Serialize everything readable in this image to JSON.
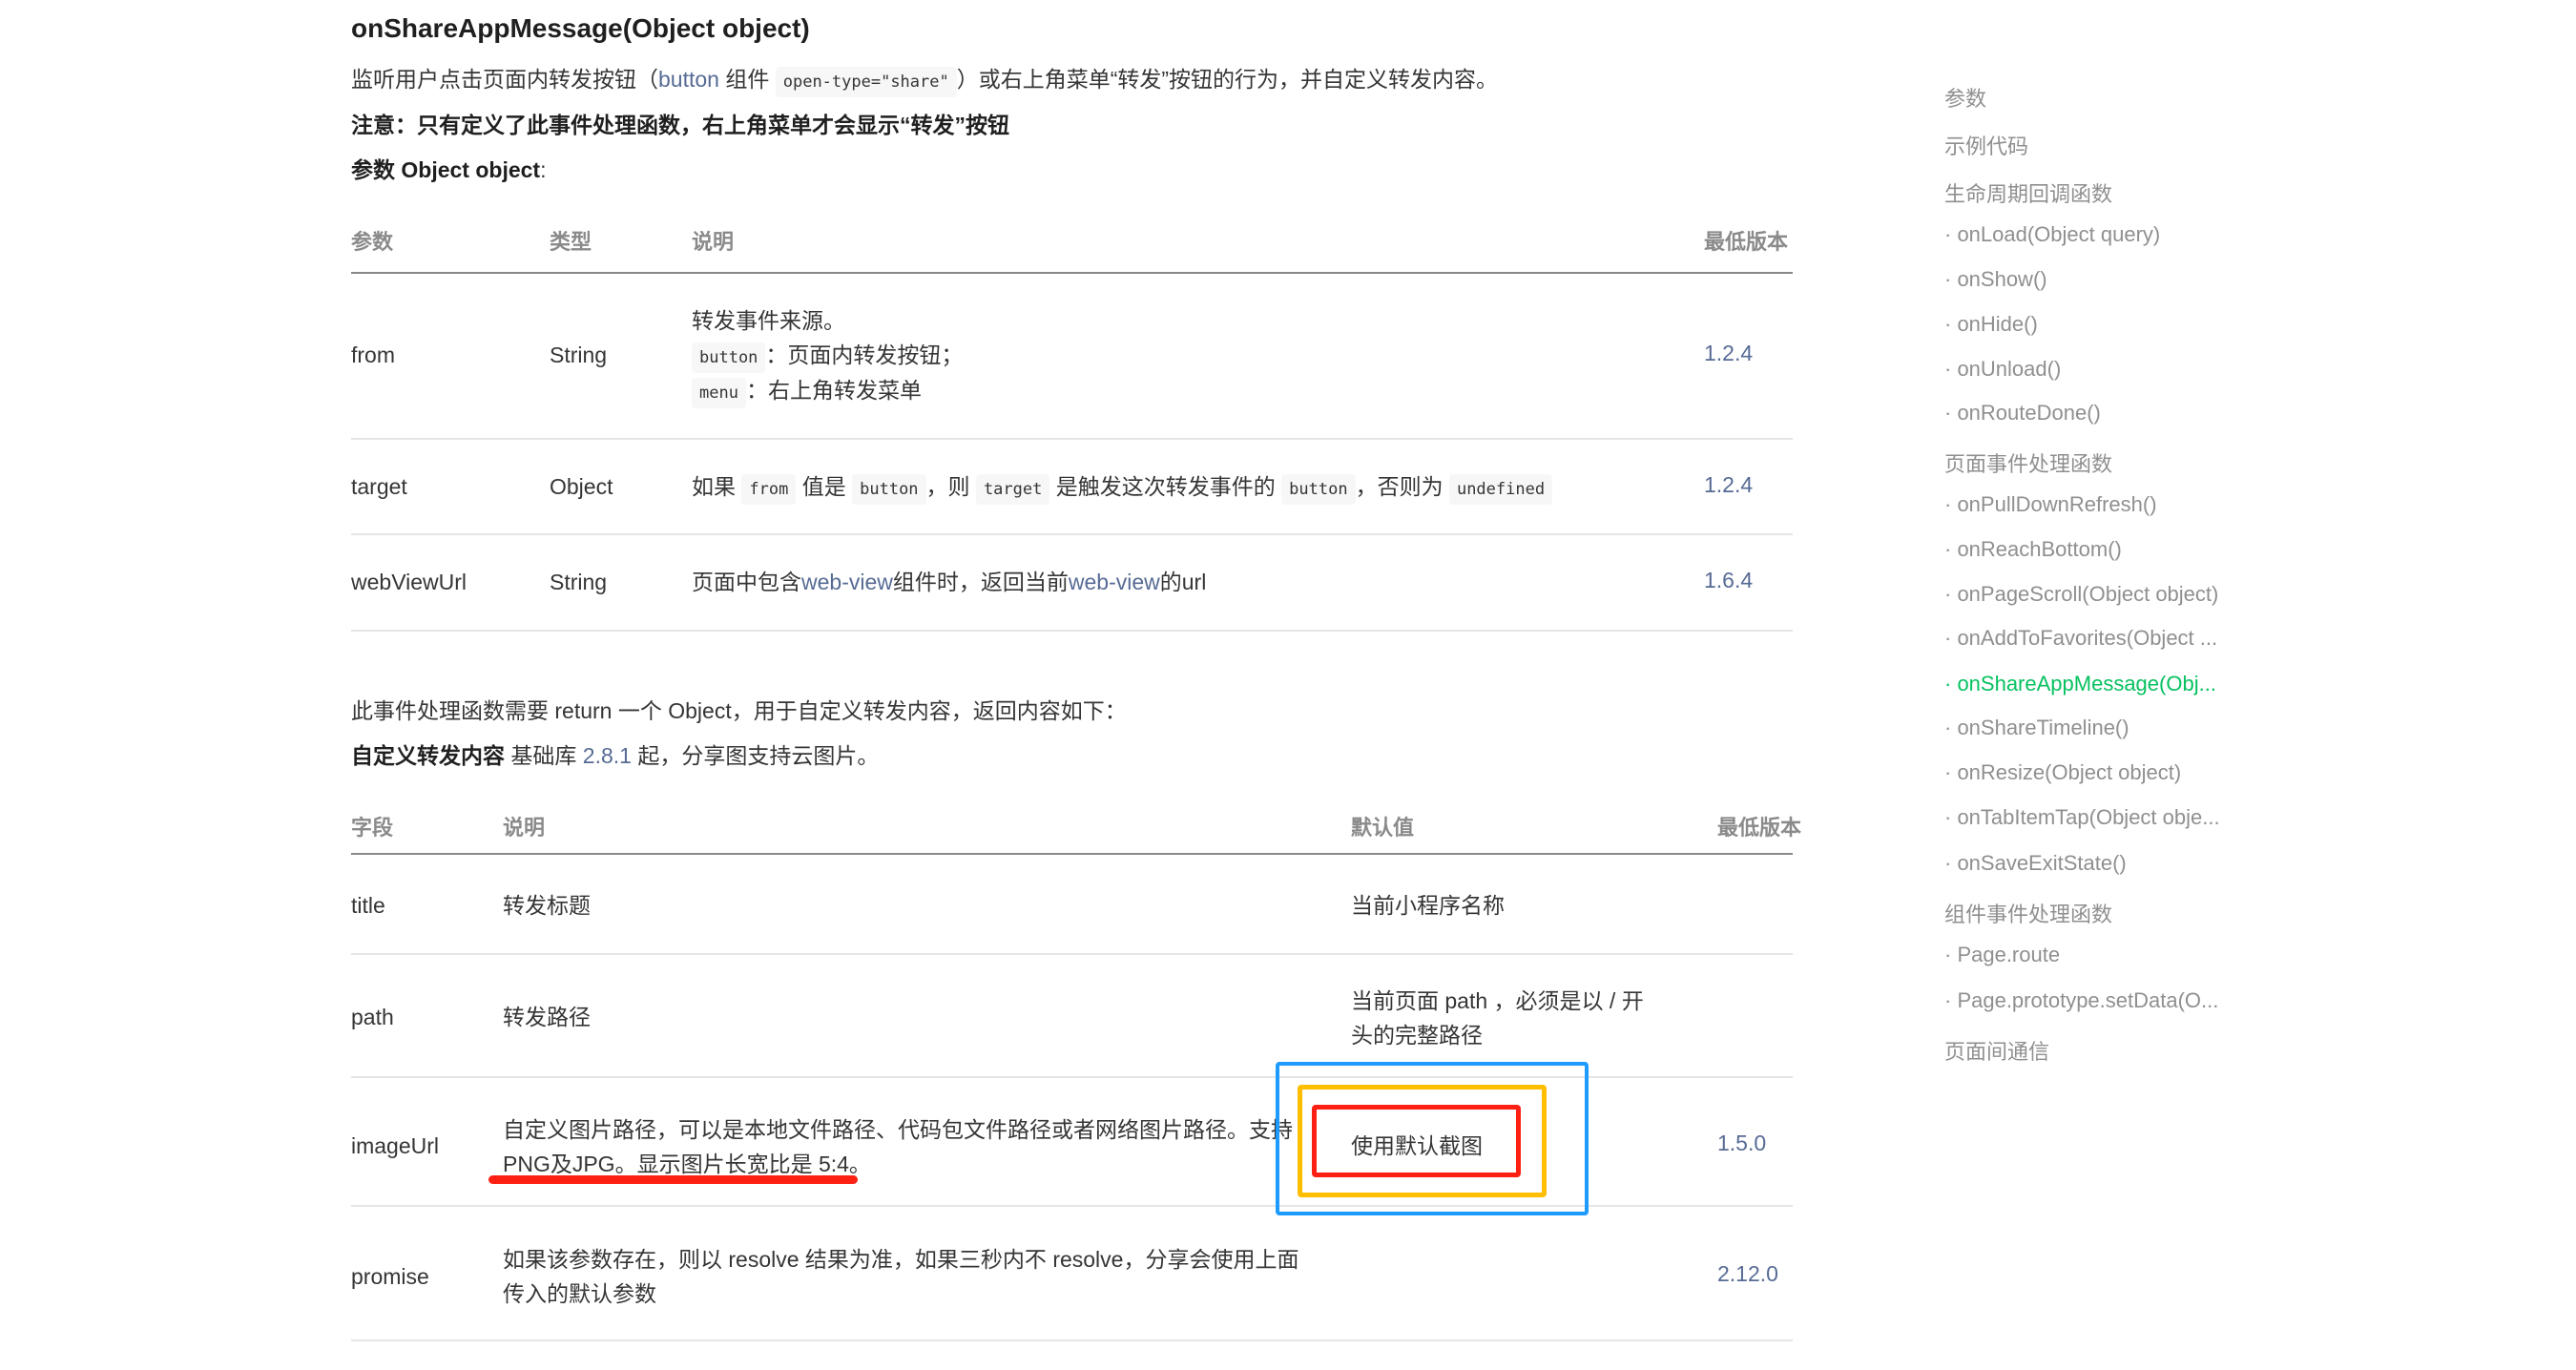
{
  "header": {
    "title": "onShareAppMessage(Object object)",
    "desc": {
      "prefix": "监听用户点击页面内转发按钮（",
      "link": "button",
      "mid": " 组件 ",
      "code": "open-type=\"share\"",
      "suffix": "）或右上角菜单“转发”按钮的行为，并自定义转发内容。"
    },
    "note": "注意：只有定义了此事件处理函数，右上角菜单才会显示“转发”按钮",
    "param_label_bold": "参数 Object object",
    "param_label_tail": ":"
  },
  "table1": {
    "headers": [
      "参数",
      "类型",
      "说明",
      "最低版本"
    ],
    "rows": [
      {
        "name": "from",
        "type": "String",
        "desc_lines": [
          {
            "text": "转发事件来源。"
          },
          {
            "code": "button",
            "text": "：页面内转发按钮；"
          },
          {
            "code": "menu",
            "text": "：右上角转发菜单"
          }
        ],
        "version": "1.2.4"
      },
      {
        "name": "target",
        "type": "Object",
        "desc_parts": [
          "如果 ",
          "from",
          " 值是 ",
          "button",
          "，则 ",
          "target",
          " 是触发这次转发事件的 ",
          "button",
          "，否则为 ",
          "undefined"
        ],
        "version": "1.2.4"
      },
      {
        "name": "webViewUrl",
        "type": "String",
        "desc_parts": [
          "页面中包含",
          "web-view",
          "组件时，返回当前",
          "web-view",
          "的url"
        ],
        "version": "1.6.4"
      }
    ]
  },
  "middle": {
    "return_text": "此事件处理函数需要 return 一个 Object，用于自定义转发内容，返回内容如下：",
    "custom_bold": "自定义转发内容",
    "custom_pre": " 基础库 ",
    "custom_link": "2.8.1",
    "custom_post": " 起，分享图支持云图片。"
  },
  "table2": {
    "headers": [
      "字段",
      "说明",
      "默认值",
      "最低版本"
    ],
    "rows": [
      {
        "field": "title",
        "desc": "转发标题",
        "default": "当前小程序名称",
        "version": ""
      },
      {
        "field": "path",
        "desc": "转发路径",
        "default_lines": [
          "当前页面 path ，必须是以 / 开",
          "头的完整路径"
        ],
        "version": ""
      },
      {
        "field": "imageUrl",
        "desc_lines": [
          "自定义图片路径，可以是本地文件路径、代码包文件路径或者网络图片路径。支持",
          "PNG及JPG。显示图片长宽比是 5:4。"
        ],
        "default": "使用默认截图",
        "version": "1.5.0"
      },
      {
        "field": "promise",
        "desc_lines": [
          "如果该参数存在，则以 resolve 结果为准，如果三秒内不 resolve，分享会使用上面",
          "传入的默认参数"
        ],
        "default": "",
        "version": "2.12.0"
      }
    ]
  },
  "annotations": {
    "blue_box_color": "#1e9bff",
    "yellow_box_color": "#ffbe00",
    "red_box_color": "#ff2014",
    "underline_color": "#ff2014"
  },
  "toc": {
    "active_color": "#07c160",
    "items": [
      {
        "label": "参数",
        "active": false
      },
      {
        "label": "示例代码",
        "active": false
      },
      {
        "label": "生命周期回调函数",
        "active": false
      },
      {
        "label": "· onLoad(Object query)",
        "active": false
      },
      {
        "label": "· onShow()",
        "active": false
      },
      {
        "label": "· onHide()",
        "active": false
      },
      {
        "label": "· onUnload()",
        "active": false
      },
      {
        "label": "· onRouteDone()",
        "active": false
      },
      {
        "label": "页面事件处理函数",
        "active": false
      },
      {
        "label": "· onPullDownRefresh()",
        "active": false
      },
      {
        "label": "· onReachBottom()",
        "active": false
      },
      {
        "label": "· onPageScroll(Object object)",
        "active": false
      },
      {
        "label": "· onAddToFavorites(Object ...",
        "active": false
      },
      {
        "label": "· onShareAppMessage(Obj...",
        "active": true
      },
      {
        "label": "· onShareTimeline()",
        "active": false
      },
      {
        "label": "· onResize(Object object)",
        "active": false
      },
      {
        "label": "· onTabItemTap(Object obje...",
        "active": false
      },
      {
        "label": "· onSaveExitState()",
        "active": false
      },
      {
        "label": "组件事件处理函数",
        "active": false
      },
      {
        "label": "· Page.route",
        "active": false
      },
      {
        "label": "· Page.prototype.setData(O...",
        "active": false
      },
      {
        "label": "页面间通信",
        "active": false
      }
    ]
  }
}
